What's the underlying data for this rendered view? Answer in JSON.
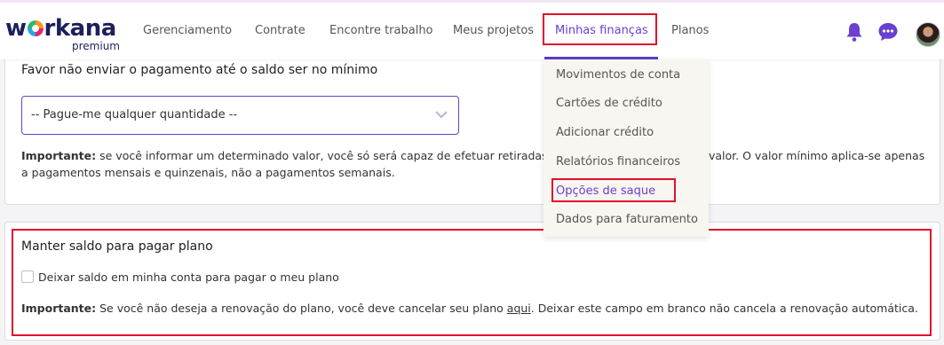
{
  "brand": {
    "name_pre": "w",
    "name_post": "rkana",
    "tier": "premium"
  },
  "nav": {
    "items": [
      {
        "label": "Gerenciamento"
      },
      {
        "label": "Contrate"
      },
      {
        "label": "Encontre trabalho"
      },
      {
        "label": "Meus projetos"
      },
      {
        "label": "Minhas finanças"
      },
      {
        "label": "Planos"
      }
    ],
    "active_index": 4
  },
  "header_icons": [
    "bell-icon",
    "chat-icon",
    "avatar"
  ],
  "colors": {
    "accent": "#6a3fd1",
    "highlight": "#e0102c",
    "brand_dark": "#1d1f5c"
  },
  "dropdown": {
    "items": [
      {
        "label": "Movimentos de conta"
      },
      {
        "label": "Cartões de crédito"
      },
      {
        "label": "Adicionar crédito"
      },
      {
        "label": "Relatórios financeiros"
      },
      {
        "label": "Opções de saque"
      },
      {
        "label": "Dados para faturamento"
      }
    ],
    "active_index": 4
  },
  "min_balance": {
    "heading": "Favor não enviar o pagamento até o saldo ser no mínimo",
    "select_value": "-- Pague-me qualquer quantidade --",
    "note_label": "Importante:",
    "note_line1_left": " se você informar um determinado valor, você só será capaz de efetuar retiradas q",
    "note_line1_right": "valor. O valor mínimo aplica-se apenas",
    "note_line2": "a pagamentos mensais e quinzenais, não a pagamentos semanais."
  },
  "keep_balance": {
    "heading": "Manter saldo para pagar plano",
    "checkbox_label": "Deixar saldo em minha conta para pagar o meu plano",
    "checkbox_checked": false,
    "note_label": "Importante:",
    "note_before_link": " Se você não deseja a renovação do plano, você deve cancelar seu plano ",
    "note_link": "aqui",
    "note_after_link": ". Deixar este campo em branco não cancela a renovação automática."
  }
}
